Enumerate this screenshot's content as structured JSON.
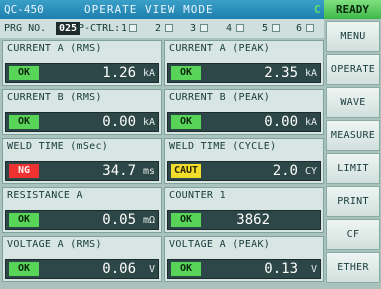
{
  "header": {
    "model": "QC-450",
    "mode": "OPERATE VIEW MODE",
    "c_indicator": "C",
    "status": "READY"
  },
  "program": {
    "prg_label": "PRG NO.",
    "prg_number": "025",
    "pctrl_label": "P-CTRL:",
    "channels": [
      "1",
      "2",
      "3",
      "4",
      "5",
      "6"
    ]
  },
  "panels": [
    {
      "title": "CURRENT A (RMS)",
      "badge": "OK",
      "value": "1.26",
      "unit": "kA"
    },
    {
      "title": "CURRENT A (PEAK)",
      "badge": "OK",
      "value": "2.35",
      "unit": "kA"
    },
    {
      "title": "CURRENT B (RMS)",
      "badge": "OK",
      "value": "0.00",
      "unit": "kA"
    },
    {
      "title": "CURRENT B (PEAK)",
      "badge": "OK",
      "value": "0.00",
      "unit": "kA"
    },
    {
      "title": "WELD TIME (mSec)",
      "badge": "NG",
      "value": "34.7",
      "unit": "ms"
    },
    {
      "title": "WELD TIME (CYCLE)",
      "badge": "CAUT",
      "value": "2.0",
      "unit": "CY"
    },
    {
      "title": "RESISTANCE A",
      "badge": "OK",
      "value": "0.05",
      "unit": "mΩ"
    },
    {
      "title": "COUNTER 1",
      "badge": "OK",
      "value": "3862",
      "unit": ""
    },
    {
      "title": "VOLTAGE A (RMS)",
      "badge": "OK",
      "value": "0.06",
      "unit": "V"
    },
    {
      "title": "VOLTAGE A (PEAK)",
      "badge": "OK",
      "value": "0.13",
      "unit": "V"
    }
  ],
  "menu": [
    "MENU",
    "OPERATE",
    "WAVE",
    "MEASURE",
    "LIMIT",
    "PRINT",
    "CF",
    "ETHER"
  ],
  "colors": {
    "ok": "#58d458",
    "ng": "#ee3131",
    "caut": "#f2de2a",
    "titlebar": "#1e7fae",
    "ready": "#3fb84a"
  }
}
